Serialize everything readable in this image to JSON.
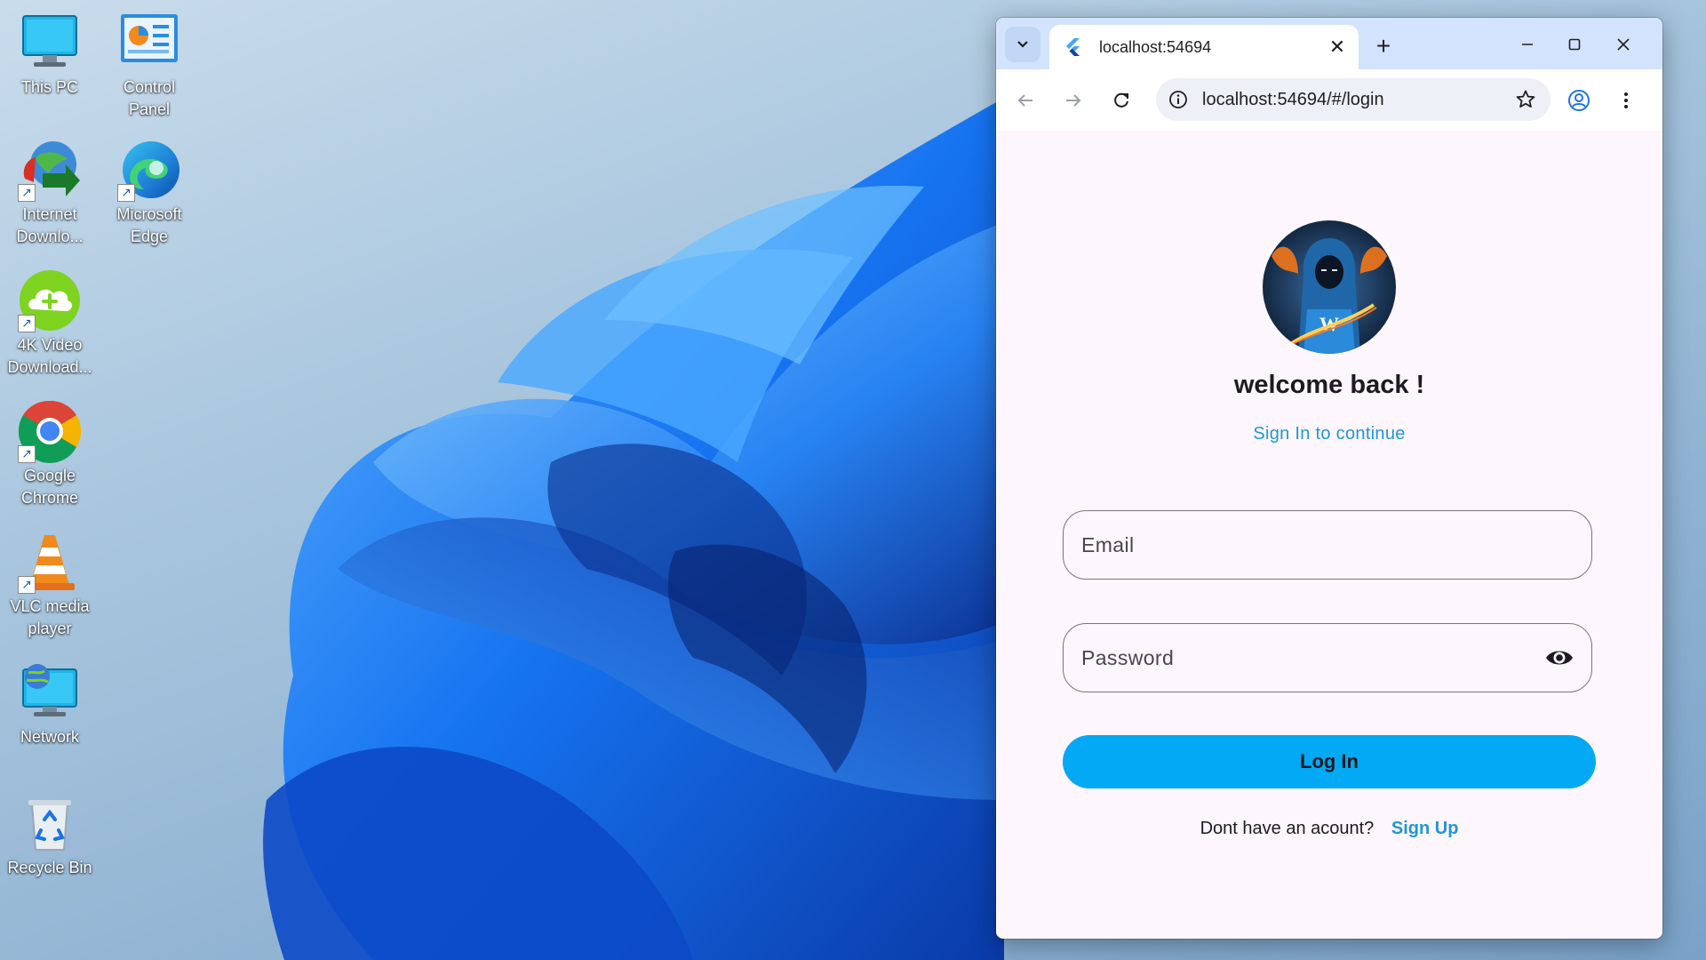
{
  "desktop": {
    "icons": [
      {
        "label": "This PC",
        "icon": "monitor-icon"
      },
      {
        "label": "Control Panel",
        "icon": "control-panel-icon"
      },
      {
        "label": "Internet Downlo...",
        "icon": "internet-download-manager-icon"
      },
      {
        "label": "Microsoft Edge",
        "icon": "edge-icon"
      },
      {
        "label": "4K Video Download...",
        "icon": "cloud-download-icon"
      },
      {
        "label": "Google Chrome",
        "icon": "chrome-icon"
      },
      {
        "label": "VLC media player",
        "icon": "vlc-cone-icon"
      },
      {
        "label": "Network",
        "icon": "network-icon"
      },
      {
        "label": "Recycle Bin",
        "icon": "recycle-bin-icon"
      }
    ]
  },
  "browser": {
    "tab": {
      "title": "localhost:54694",
      "favicon": "flutter-icon"
    },
    "url": "localhost:54694/#/login"
  },
  "login": {
    "heading": "welcome back !",
    "subtitle": "Sign In to continue",
    "email_placeholder": "Email",
    "password_placeholder": "Password",
    "login_button": "Log In",
    "signup_prompt": "Dont have an acount?",
    "signup_link": "Sign Up"
  },
  "colors": {
    "accent": "#03a9f4",
    "link": "#2196d3",
    "page_bg": "#fdf6fd",
    "tabbar_bg": "#d3e3fd"
  }
}
